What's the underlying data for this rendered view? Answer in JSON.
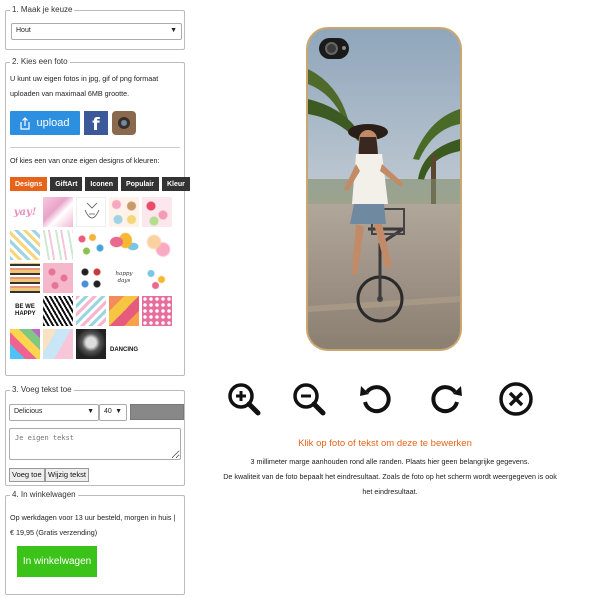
{
  "step1": {
    "title": "1. Maak je keuze",
    "selected": "Hout"
  },
  "step2": {
    "title": "2. Kies een foto",
    "intro": "U kunt uw eigen fotos in jpg, gif of png formaat uploaden van maximaal 6MB grootte.",
    "upload_label": "upload",
    "designs_intro": "Of kies een van onze eigen designs of kleuren:",
    "tabs": [
      "Designs",
      "GiftArt",
      "Iconen",
      "Populair",
      "Kleur"
    ],
    "tile_texts": {
      "yay": "yay!",
      "happy_days": "happy days",
      "we_happy": "BE WE HAPPY",
      "dancing": "DANCING"
    }
  },
  "step3": {
    "title": "3. Voeg tekst toe",
    "font": "Delicious",
    "size": "40",
    "placeholder": "Je eigen tekst",
    "add_label": "Voeg toe",
    "edit_label": "Wijzig tekst"
  },
  "step4": {
    "title": "4. In winkelwagen",
    "delivery": "Op werkdagen voor 13 uur besteld, morgen in huis | € 19,95 (Gratis verzending)",
    "cart_label": "In winkelwagen"
  },
  "editor": {
    "tools": [
      "zoom-in-icon",
      "zoom-out-icon",
      "rotate-left-icon",
      "rotate-right-icon",
      "delete-icon"
    ],
    "hint": "Klik op foto of tekst om deze te bewerken",
    "note1": "3 millimeter marge aanhouden rond alle randen. Plaats hier geen belangrijke gegevens.",
    "note2": "De kwaliteit van de foto bepaalt het eindresultaat. Zoals de foto op het scherm wordt weergegeven is ook",
    "note3": "het eindresultaat."
  },
  "colors": {
    "accent": "#e8631a",
    "upload": "#2d8fe0",
    "cart": "#3cc31a"
  }
}
